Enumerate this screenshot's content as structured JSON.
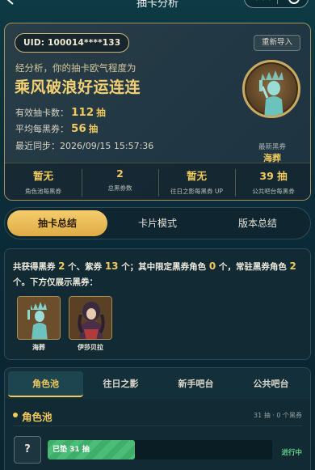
{
  "header": {
    "title": "抽卡分析"
  },
  "summary": {
    "uid": "UID: 100014****133",
    "reimport_label": "重新导入",
    "luck_intro": "经分析，你的抽卡欧气程度为",
    "luck_title": "乘风破浪好运连连",
    "effective_label": "有效抽卡数：",
    "effective_value": "112",
    "effective_unit": "抽",
    "avg_label": "平均每黑券：",
    "avg_value": "56",
    "avg_unit": "抽",
    "sync_label": "最近同步：",
    "sync_time": "2026/09/15 15:57:36",
    "latest_label": "最新黑券",
    "latest_name": "海葬",
    "stats": [
      {
        "value": "暂无",
        "label": "角色池每黑券"
      },
      {
        "value": "2",
        "label": "总黑券数"
      },
      {
        "value": "暂无",
        "label": "往日之影每黑券 UP"
      },
      {
        "value": "39 抽",
        "label": "公共吧台每黑券"
      }
    ]
  },
  "tabs": [
    "抽卡总结",
    "卡片模式",
    "版本总结"
  ],
  "overview": {
    "t1": "共获得黑券",
    "n1": "2",
    "t2": "个、紫券",
    "n2": "13",
    "t3": "个；其中限定黑券角色",
    "n3": "0",
    "t4": "个，常驻黑券角色",
    "n4": "2",
    "t5": "个。下方仅展示黑券：",
    "characters": [
      {
        "name": "海葬",
        "icon": "statue-character-icon"
      },
      {
        "name": "伊莎贝拉",
        "icon": "dark-lady-character-icon"
      }
    ]
  },
  "pool": {
    "tabs": [
      "角色池",
      "往日之影",
      "新手吧台",
      "公共吧台"
    ],
    "heading": "角色池",
    "summary": "31 抽 · 0 个黑券",
    "unknown_label": "?",
    "progress_text": "已垫 31 抽",
    "progress_fraction": 0.39,
    "status": "进行中"
  },
  "colors": {
    "accent_gold": "#f2c95c",
    "active_tab": "#e0ab45",
    "progress_green": "#3fae6a"
  }
}
